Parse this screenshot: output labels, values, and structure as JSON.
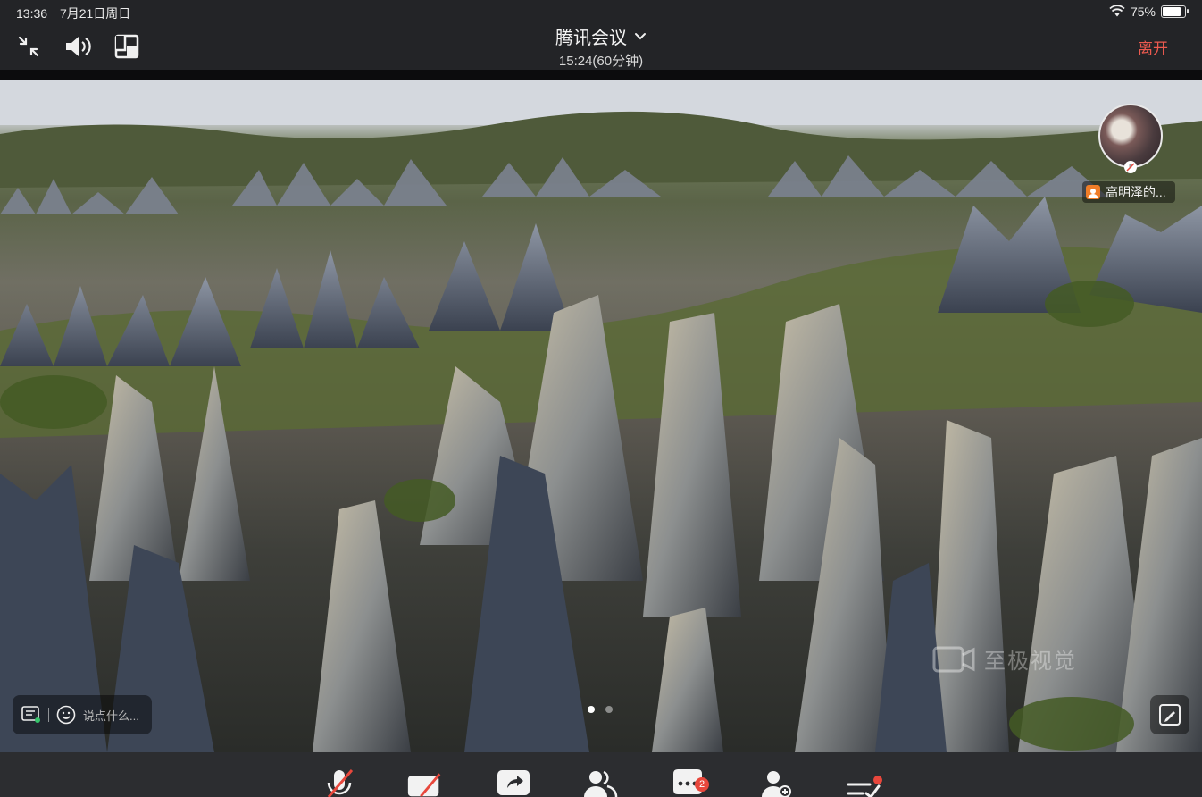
{
  "status_bar": {
    "time": "13:36",
    "date": "7月21日周日",
    "battery": "75%"
  },
  "header": {
    "title": "腾讯会议",
    "duration": "15:24(60分钟)",
    "leave_label": "离开",
    "icons": [
      "minimize-icon",
      "speaker-icon",
      "layout-icon",
      "chevron-down-icon"
    ]
  },
  "video": {
    "participant_name": "高明泽的...",
    "watermark": "至极视觉",
    "chat_placeholder": "说点什么...",
    "page_count": 2,
    "active_page": 1
  },
  "toolbar": {
    "message_badge": "2",
    "buttons": [
      "mic-muted-icon",
      "camera-off-icon",
      "share-screen-icon",
      "participants-icon",
      "chat-icon",
      "invite-icon",
      "settings-icon"
    ]
  },
  "colors": {
    "accent_leave": "#ec5a4f",
    "badge_red": "#e8473c",
    "toolbar_bg": "#2c2d30",
    "header_bg": "#232427"
  }
}
